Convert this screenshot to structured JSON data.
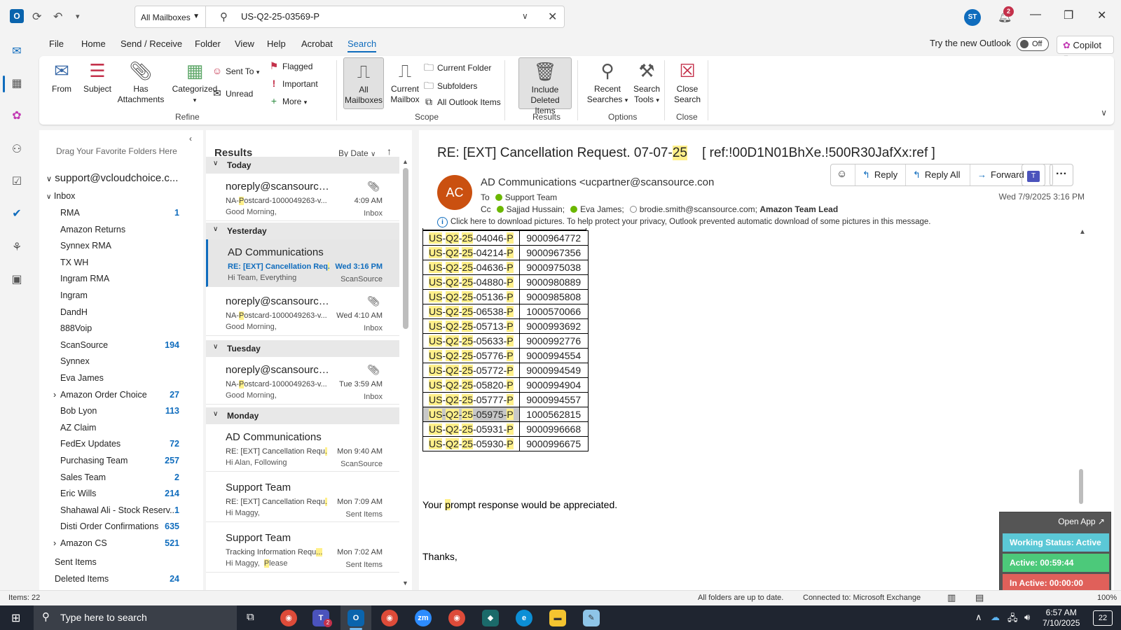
{
  "titlebar": {
    "mailbox_scope": "All Mailboxes",
    "search_query": "US-Q2-25-03569-P",
    "avatar_initials": "ST",
    "notification_count": "2"
  },
  "menu": {
    "tabs": [
      "File",
      "Home",
      "Send / Receive",
      "Folder",
      "View",
      "Help",
      "Acrobat",
      "Search"
    ],
    "try_new_outlook": "Try the new Outlook",
    "toggle_state": "Off",
    "copilot": "Copilot"
  },
  "ribbon": {
    "from": "From",
    "subject": "Subject",
    "has_attachments_1": "Has",
    "has_attachments_2": "Attachments",
    "categorized": "Categorized",
    "sent_to": "Sent To",
    "unread": "Unread",
    "flagged": "Flagged",
    "important": "Important",
    "more": "More",
    "refine_label": "Refine",
    "all_mailboxes_1": "All",
    "all_mailboxes_2": "Mailboxes",
    "current_mailbox_1": "Current",
    "current_mailbox_2": "Mailbox",
    "current_folder": "Current Folder",
    "subfolders": "Subfolders",
    "all_outlook_items": "All Outlook Items",
    "scope_label": "Scope",
    "include_deleted_1": "Include",
    "include_deleted_2": "Deleted Items",
    "results_label": "Results",
    "recent_searches_1": "Recent",
    "recent_searches_2": "Searches",
    "search_tools_1": "Search",
    "search_tools_2": "Tools",
    "options_label": "Options",
    "close_search_1": "Close",
    "close_search_2": "Search",
    "close_label": "Close"
  },
  "folderpane": {
    "drag_favorites": "Drag Your Favorite Folders Here",
    "account": "support@vcloudchoice.c...",
    "inbox": "Inbox",
    "folders": [
      {
        "name": "RMA",
        "count": "1"
      },
      {
        "name": "Amazon Returns",
        "count": ""
      },
      {
        "name": "Synnex RMA",
        "count": ""
      },
      {
        "name": "TX WH",
        "count": ""
      },
      {
        "name": "Ingram RMA",
        "count": ""
      },
      {
        "name": "Ingram",
        "count": ""
      },
      {
        "name": "DandH",
        "count": ""
      },
      {
        "name": "888Voip",
        "count": ""
      },
      {
        "name": "ScanSource",
        "count": "194"
      },
      {
        "name": "Synnex",
        "count": ""
      },
      {
        "name": "Eva James",
        "count": ""
      },
      {
        "name": "Amazon Order Choice",
        "count": "27"
      },
      {
        "name": "Bob Lyon",
        "count": "113"
      },
      {
        "name": "AZ Claim",
        "count": ""
      },
      {
        "name": "FedEx Updates",
        "count": "72"
      },
      {
        "name": "Purchasing Team",
        "count": "257"
      },
      {
        "name": "Sales Team",
        "count": "2"
      },
      {
        "name": "Eric Wills",
        "count": "214"
      },
      {
        "name": "Shahawal Ali - Stock Reserv...",
        "count": "1"
      },
      {
        "name": "Disti Order Confirmations",
        "count": "635"
      },
      {
        "name": "Amazon CS",
        "count": "521"
      }
    ],
    "sent_items": "Sent Items",
    "deleted_items": "Deleted Items",
    "deleted_count": "24"
  },
  "msglist": {
    "title": "Results",
    "sort": "By Date",
    "groups": {
      "today": "Today",
      "yesterday": "Yesterday",
      "tuesday": "Tuesday",
      "monday": "Monday"
    },
    "messages": [
      {
        "sender": "noreply@scansource....",
        "subject_pre": "NA-",
        "subject_hl": "P",
        "subject_post": "ostcard-1000049263-v...",
        "preview": "Good Morning,",
        "time": "4:09 AM",
        "folder": "Inbox"
      },
      {
        "sender": "AD Communications",
        "subject_pre": "RE: [EXT] Cancellation Req",
        "subject_hl": "...",
        "subject_post": "",
        "preview": "Hi Team,  Everything",
        "time": "Wed 3:16 PM",
        "folder": "ScanSource"
      },
      {
        "sender": "noreply@scansource....",
        "subject_pre": "NA-",
        "subject_hl": "P",
        "subject_post": "ostcard-1000049263-v...",
        "preview": "Good Morning,",
        "time": "Wed 4:10 AM",
        "folder": "Inbox"
      },
      {
        "sender": "noreply@scansource....",
        "subject_pre": "NA-",
        "subject_hl": "P",
        "subject_post": "ostcard-1000049263-v...",
        "preview": "Good Morning,",
        "time": "Tue 3:59 AM",
        "folder": "Inbox"
      },
      {
        "sender": "AD Communications",
        "subject_pre": "RE: [EXT] Cancellation Requ",
        "subject_hl": "...",
        "subject_post": "",
        "preview": "Hi Alan,  Following",
        "time": "Mon 9:40 AM",
        "folder": "ScanSource"
      },
      {
        "sender": "Support Team",
        "subject_pre": "RE: [EXT] Cancellation Requ",
        "subject_hl": "...",
        "subject_post": "",
        "preview": "Hi Maggy,",
        "time": "Mon 7:09 AM",
        "folder": "Sent Items"
      },
      {
        "sender": "Support Team",
        "subject_pre": "Tracking Information Requ",
        "subject_hl": "...",
        "subject_post": "",
        "preview_pre": "Hi Maggy,  ",
        "preview_hl": "P",
        "preview_post": "lease",
        "time": "Mon 7:02 AM",
        "folder": "Sent Items"
      }
    ]
  },
  "reading": {
    "subject_pre": "RE: [EXT] Cancellation Request. 07-07-",
    "subject_hl": "25",
    "subject_post": "    [ ref:!00D1N01BhXe.!500R30JafXx:ref ]",
    "avatar_initials": "AC",
    "from": "AD Communications <ucpartner@scansource.con",
    "to_label": "To",
    "to": "Support Team",
    "cc_label": "Cc",
    "cc_1": "Sajjad Hussain;",
    "cc_2": "Eva James;",
    "cc_3": "brodie.smith@scansource.com;",
    "cc_4": "Amazon Team Lead",
    "date": "Wed 7/9/2025 3:16 PM",
    "info": "Click here to download pictures. To help protect your privacy, Outlook prevented automatic download of some pictures in this message.",
    "actions": {
      "reply": "Reply",
      "reply_all": "Reply All",
      "forward": "Forward"
    },
    "orders": [
      {
        "code": "04046",
        "num": "9000964772"
      },
      {
        "code": "04214",
        "num": "9000967356"
      },
      {
        "code": "04636",
        "num": "9000975038"
      },
      {
        "code": "04880",
        "num": "9000980889"
      },
      {
        "code": "05136",
        "num": "9000985808"
      },
      {
        "code": "06538",
        "num": "1000570066"
      },
      {
        "code": "05713",
        "num": "9000993692"
      },
      {
        "code": "05633",
        "num": "9000992776"
      },
      {
        "code": "05776",
        "num": "9000994554"
      },
      {
        "code": "05772",
        "num": "9000994549"
      },
      {
        "code": "05820",
        "num": "9000994904"
      },
      {
        "code": "05777",
        "num": "9000994557"
      },
      {
        "code": "05975",
        "num": "1000562815",
        "selected": true
      },
      {
        "code": "05931",
        "num": "9000996668"
      },
      {
        "code": "05930",
        "num": "9000996675"
      }
    ],
    "body_1_pre": "Your ",
    "body_1_hl": "p",
    "body_1_post": "rompt response would be appreciated.",
    "body_2": "Thanks,"
  },
  "widget": {
    "open_app": "Open App ↗",
    "working_status": "Working Status: Active",
    "active": "Active: 00:59:44",
    "inactive": "In Active: 00:00:00",
    "colors": {
      "status": "#5bc8d6",
      "active": "#4cc97a",
      "inactive": "#e0605a"
    }
  },
  "statusbar": {
    "items": "Items: 22",
    "sync": "All folders are up to date.",
    "connection": "Connected to: Microsoft Exchange",
    "zoom": "100%"
  },
  "taskbar": {
    "search_placeholder": "Type here to search",
    "time": "6:57 AM",
    "date": "7/10/2025",
    "notifications": "22",
    "teams_badge": "2"
  },
  "colors": {
    "accent": "#0f6cbd",
    "highlight": "#fff08a",
    "avatar": "#ca5010"
  }
}
